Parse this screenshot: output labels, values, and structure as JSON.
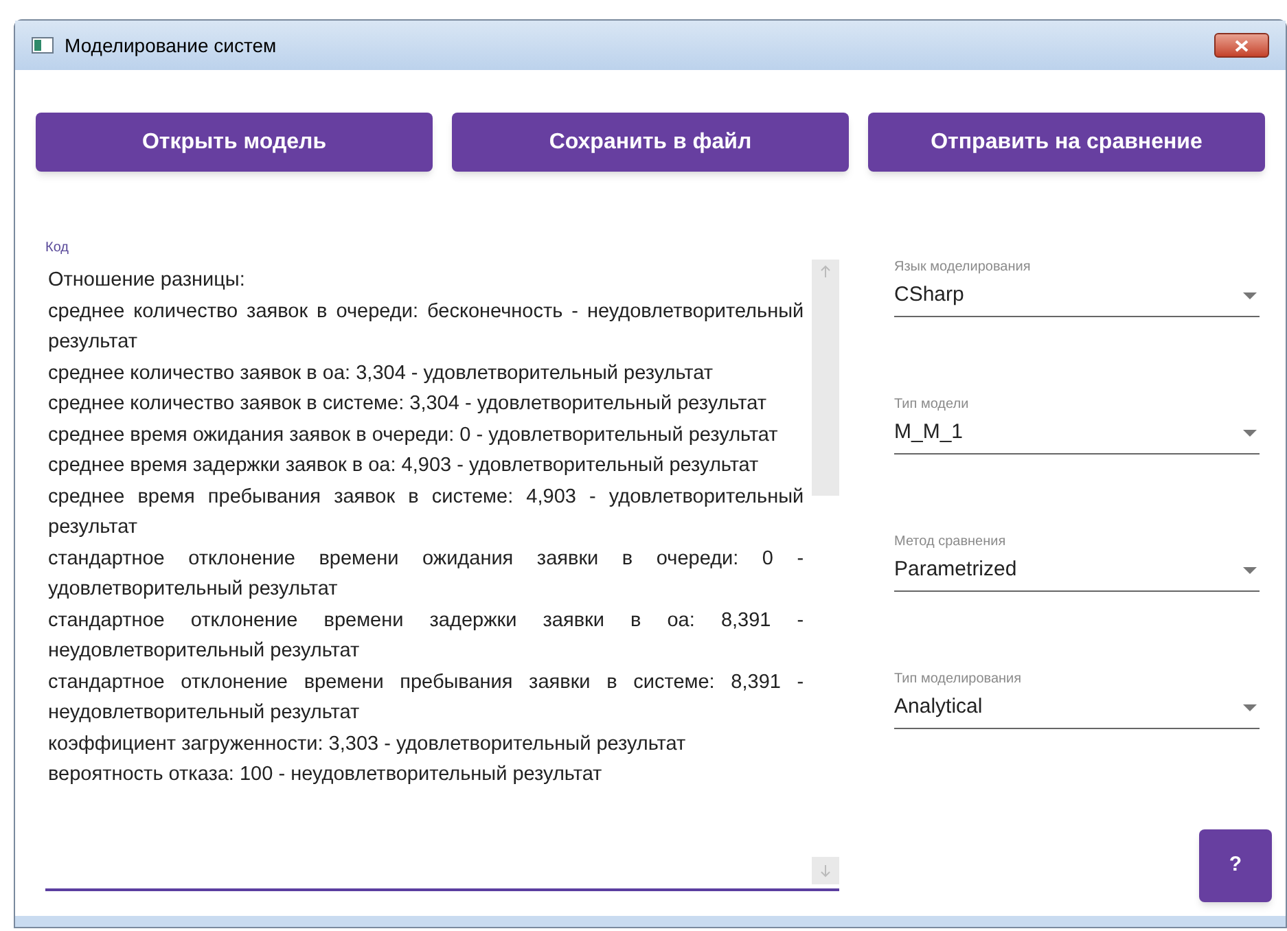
{
  "window": {
    "title": "Моделирование систем"
  },
  "buttons": [
    "Открыть модель",
    "Сохранить в файл",
    "Отправить на сравнение"
  ],
  "code_field": {
    "label": "Код",
    "lines": [
      "Отношение разницы:",
      "среднее количество заявок в очереди: бесконечность - неудовлетворительный результат",
      "среднее количество заявок в оа: 3,304 - удовлетворительный результат",
      "среднее количество заявок в системе: 3,304 - удовлетворительный результат",
      "среднее время ожидания заявок в очереди: 0 - удовлетворительный результат",
      "среднее время задержки заявок в оа: 4,903 - удовлетворительный результат",
      "среднее время пребывания заявок в системе: 4,903 - удовлетворительный результат",
      "стандартное отклонение времени ожидания заявки в очереди: 0 - удовлетворительный результат",
      "стандартное отклонение времени задержки заявки в оа: 8,391 - неудовлетворительный результат",
      "стандартное отклонение времени пребывания заявки в системе: 8,391 - неудовлетворительный результат",
      "коэффициент загруженности: 3,303 - удовлетворительный результат",
      "вероятность отказа: 100 - неудовлетворительный результат"
    ]
  },
  "selects": [
    {
      "label": "Язык моделирования",
      "value": "CSharp"
    },
    {
      "label": "Тип модели",
      "value": "M_M_1"
    },
    {
      "label": "Метод сравнения",
      "value": "Parametrized"
    },
    {
      "label": "Тип моделирования",
      "value": "Analytical"
    }
  ],
  "help_button": "?"
}
